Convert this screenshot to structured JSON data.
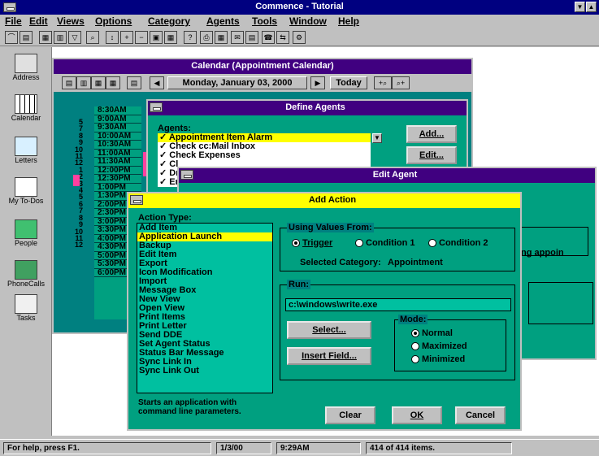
{
  "app": {
    "title": "Commence - Tutorial"
  },
  "menu": [
    "File",
    "Edit",
    "Views",
    "Options",
    "Category",
    "Agents",
    "Tools",
    "Window",
    "Help"
  ],
  "sidebar": [
    {
      "label": "Address",
      "icon": "address-book-icon"
    },
    {
      "label": "Calendar",
      "icon": "calendar-icon"
    },
    {
      "label": "Letters",
      "icon": "letters-icon"
    },
    {
      "label": "My To-Dos",
      "icon": "todo-icon"
    },
    {
      "label": "People",
      "icon": "people-icon"
    },
    {
      "label": "PhoneCalls",
      "icon": "phone-icon"
    },
    {
      "label": "Tasks",
      "icon": "tasks-icon"
    }
  ],
  "calendar": {
    "title": "Calendar (Appointment Calendar)",
    "date": "Monday, January 03, 2000",
    "today_label": "Today",
    "times": [
      "8:30AM",
      "9:00AM",
      "9:30AM",
      "10:00AM",
      "10:30AM",
      "11:00AM",
      "11:30AM",
      "12:00PM",
      "12:30PM",
      "1:00PM",
      "1:30PM",
      "2:00PM",
      "2:30PM",
      "3:00PM",
      "3:30PM",
      "4:00PM",
      "4:30PM",
      "5:00PM",
      "5:30PM",
      "6:00PM"
    ],
    "days": [
      "5",
      "7",
      "8",
      "9",
      "10",
      "11",
      "12",
      "1",
      "2",
      "3",
      "4",
      "5",
      "6",
      "7",
      "8",
      "9",
      "10",
      "11",
      "12"
    ]
  },
  "define_agents": {
    "title": "Define Agents",
    "label": "Agents:",
    "items": [
      "Appointment Item Alarm",
      "Check cc:Mail Inbox",
      "Check Expenses",
      "Cl",
      "Dr",
      "Er"
    ],
    "add_label": "Add...",
    "edit_label": "Edit..."
  },
  "edit_agent": {
    "title": "Edit Agent",
    "partial_text": "ing appoin"
  },
  "add_action": {
    "title": "Add Action",
    "action_type_label": "Action Type:",
    "action_types": [
      "Add Item",
      "Application Launch",
      "Backup",
      "Edit Item",
      "Export",
      "Icon Modification",
      "Import",
      "Message Box",
      "New View",
      "Open View",
      "Print Items",
      "Print Letter",
      "Send DDE",
      "Set Agent Status",
      "Status Bar Message",
      "Sync Link In",
      "Sync Link Out"
    ],
    "selected_index": 1,
    "using_values_label": "Using Values From:",
    "trigger_label": "Trigger",
    "condition1_label": "Condition 1",
    "condition2_label": "Condition 2",
    "selected_category_label": "Selected Category:",
    "selected_category_value": "Appointment",
    "run_label": "Run:",
    "run_value": "c:\\windows\\write.exe",
    "select_label": "Select...",
    "insert_field_label": "Insert Field...",
    "mode_label": "Mode:",
    "mode_normal": "Normal",
    "mode_maximized": "Maximized",
    "mode_minimized": "Minimized",
    "description": "Starts an application with command line parameters.",
    "clear_label": "Clear",
    "ok_label": "OK",
    "cancel_label": "Cancel"
  },
  "status": {
    "help": "For help, press F1.",
    "date": "1/3/00",
    "time": "9:29AM",
    "items": "414 of 414 items."
  }
}
